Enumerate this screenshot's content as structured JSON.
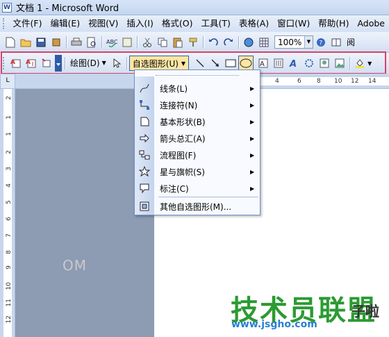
{
  "window": {
    "title": "文档 1 - Microsoft Word",
    "app_icon_label": "W"
  },
  "menubar": {
    "items": [
      "文件(F)",
      "编辑(E)",
      "视图(V)",
      "插入(I)",
      "格式(O)",
      "工具(T)",
      "表格(A)",
      "窗口(W)",
      "帮助(H)",
      "Adobe"
    ]
  },
  "standard_toolbar": {
    "zoom": "100%",
    "reading_label": "阅"
  },
  "drawing_toolbar": {
    "draw_label": "绘图(D)",
    "autoshapes_label": "自选图形(U)"
  },
  "autoshapes_menu": {
    "items": [
      {
        "label": "线条(L)",
        "icon": "lines-icon",
        "submenu": true
      },
      {
        "label": "连接符(N)",
        "icon": "connectors-icon",
        "submenu": true
      },
      {
        "label": "基本形状(B)",
        "icon": "basic-shapes-icon",
        "submenu": true
      },
      {
        "label": "箭头总汇(A)",
        "icon": "block-arrows-icon",
        "submenu": true
      },
      {
        "label": "流程图(F)",
        "icon": "flowchart-icon",
        "submenu": true
      },
      {
        "label": "星与旗帜(S)",
        "icon": "stars-banners-icon",
        "submenu": true
      },
      {
        "label": "标注(C)",
        "icon": "callouts-icon",
        "submenu": true
      },
      {
        "label": "其他自选图形(M)...",
        "icon": "more-autoshapes-icon",
        "submenu": false
      }
    ]
  },
  "ruler": {
    "h_ticks": [
      "4",
      "6",
      "8",
      "10",
      "12",
      "14"
    ],
    "v_ticks": [
      "2",
      "1",
      "1",
      "2",
      "3",
      "4",
      "5",
      "6",
      "7",
      "8",
      "9",
      "10",
      "11",
      "12"
    ],
    "corner": "L"
  },
  "watermarks": {
    "small": "OM",
    "big": "技术员联盟",
    "side": "子啦",
    "url": "www.jsgho.com"
  },
  "colors": {
    "highlight": "#d6426a",
    "menu_accent": "#fde6a4"
  }
}
